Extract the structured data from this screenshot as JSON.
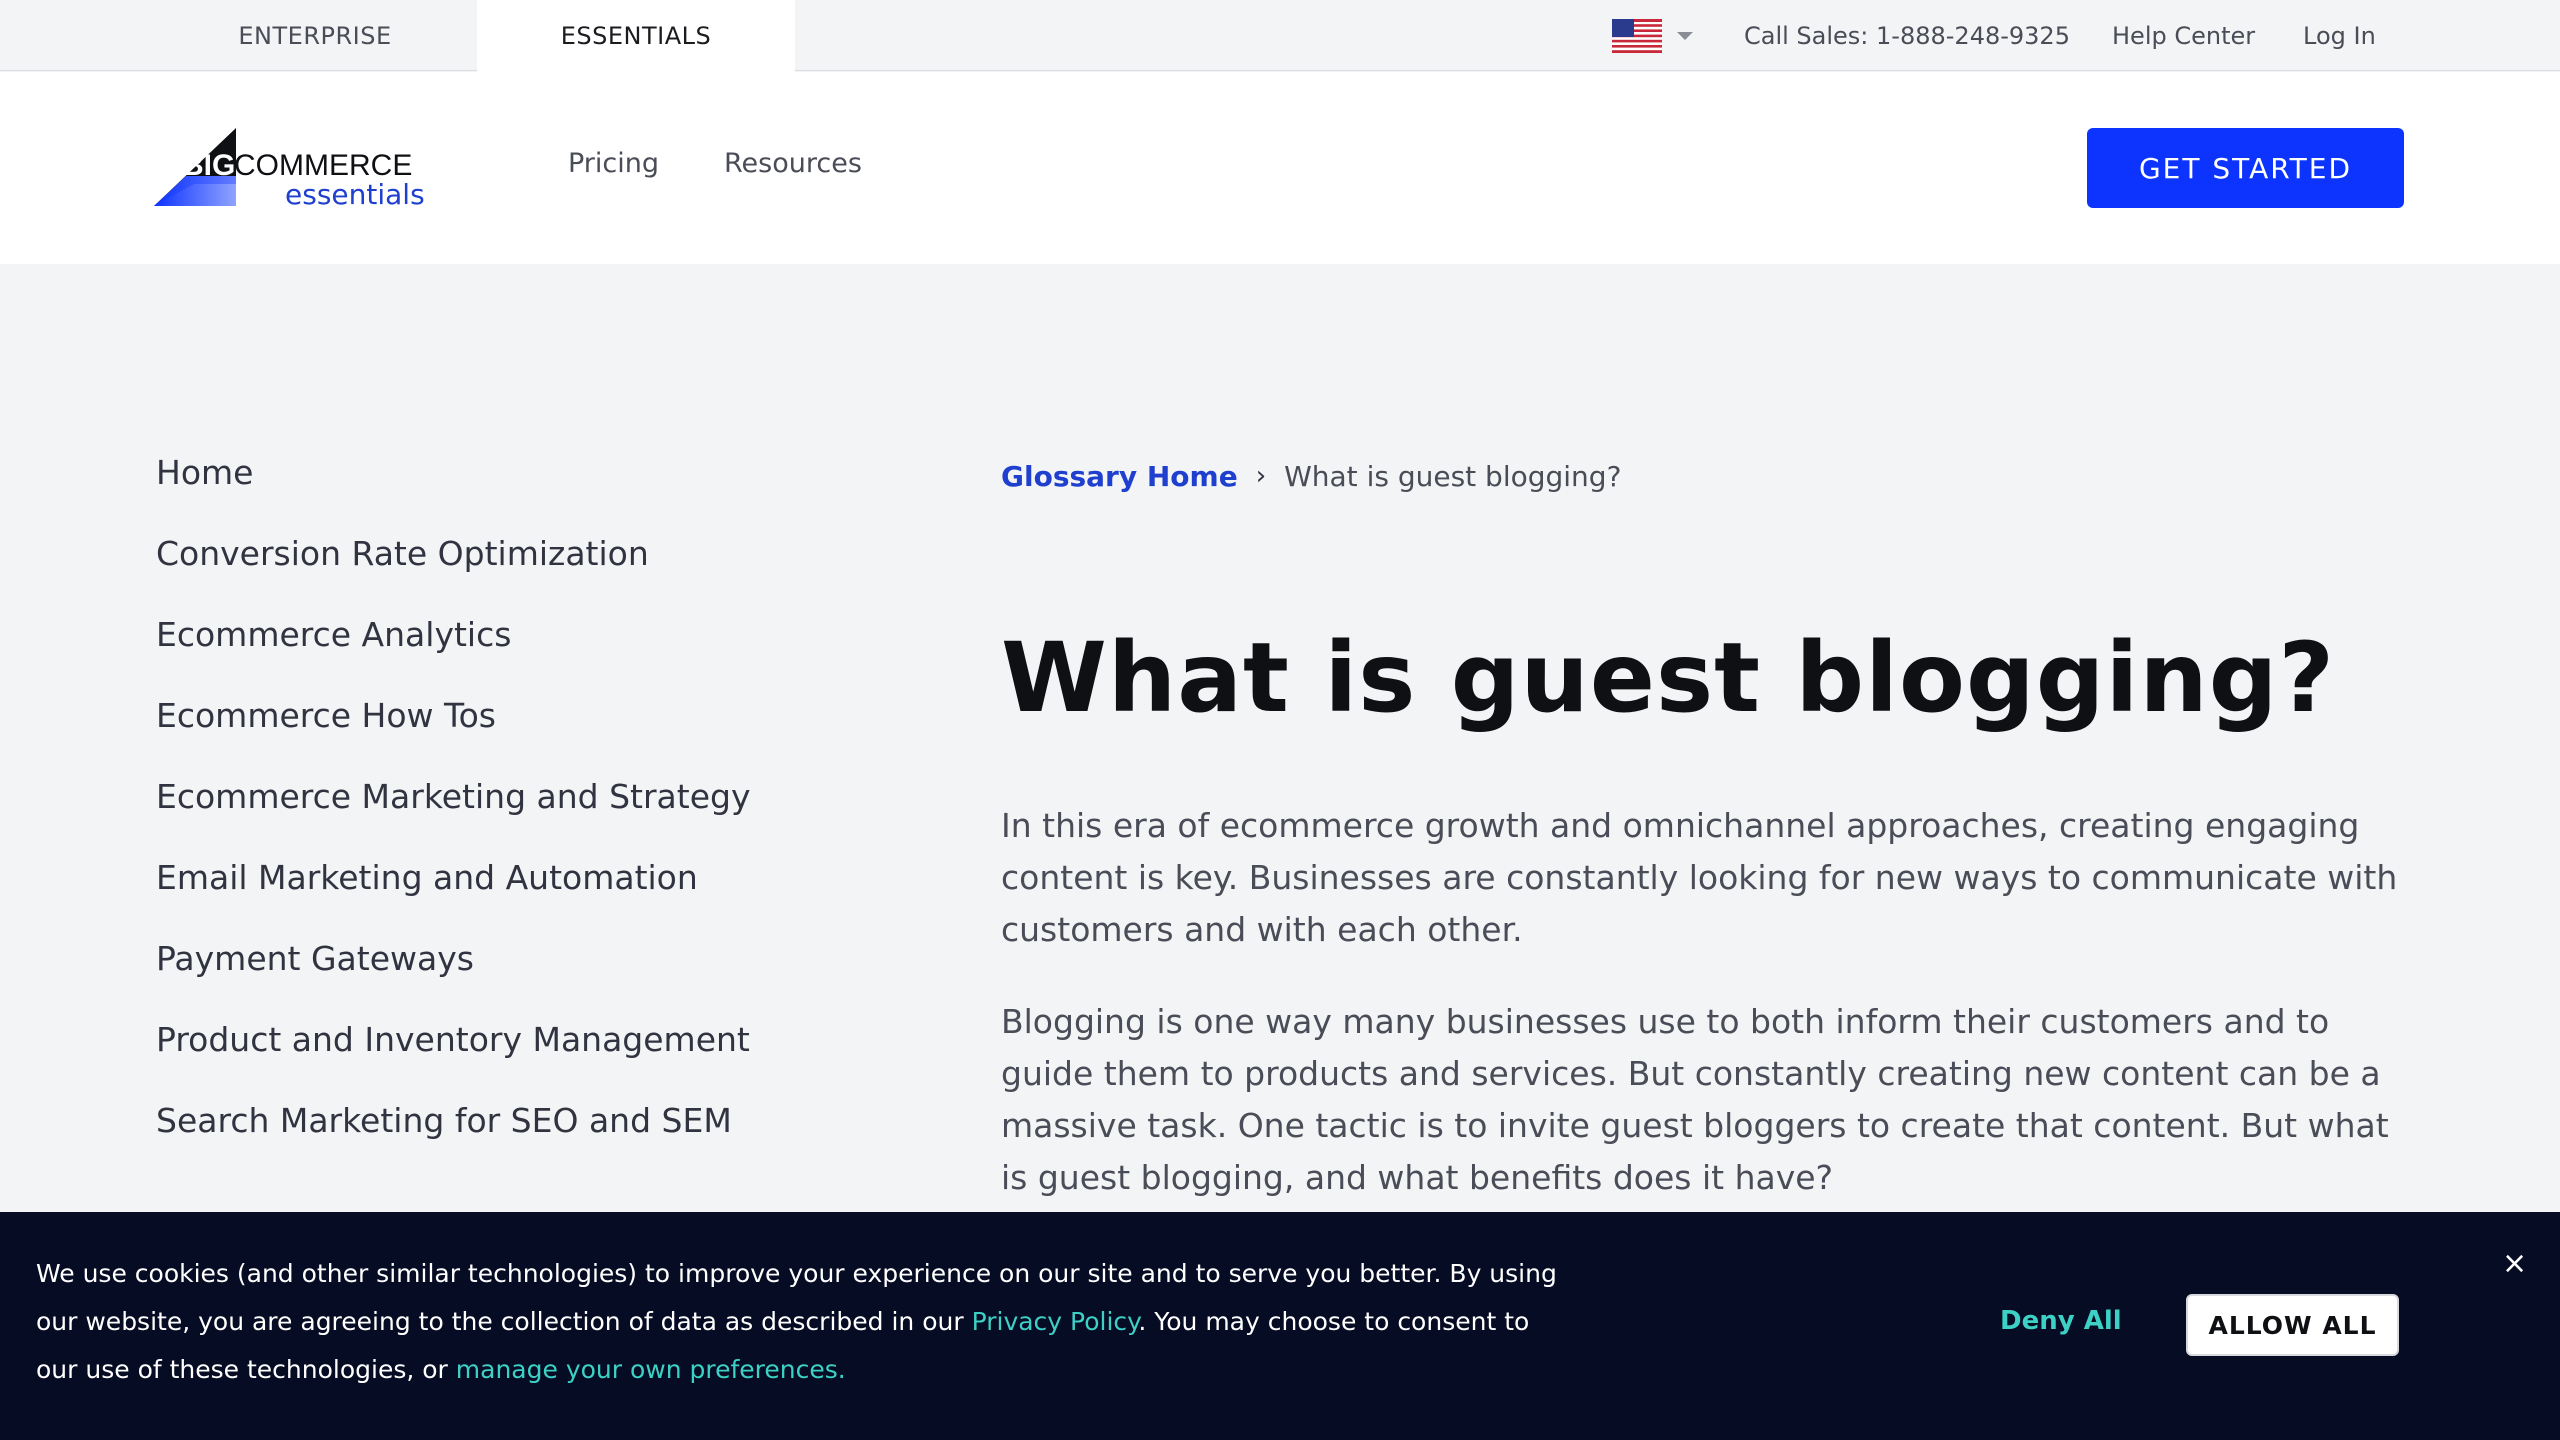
{
  "topbar": {
    "tabs": [
      {
        "label": "ENTERPRISE",
        "active": false
      },
      {
        "label": "ESSENTIALS",
        "active": true
      }
    ],
    "region_icon": "us-flag-icon",
    "call_sales": "Call Sales: 1-888-248-9325",
    "help_center": "Help Center",
    "login": "Log In"
  },
  "header": {
    "logo": {
      "big": "BIG",
      "commerce": "COMMERCE",
      "essentials": "essentials"
    },
    "nav": [
      "Pricing",
      "Resources"
    ],
    "cta": "GET STARTED"
  },
  "sidebar": {
    "items": [
      "Home",
      "Conversion Rate Optimization",
      "Ecommerce Analytics",
      "Ecommerce How Tos",
      "Ecommerce Marketing and Strategy",
      "Email Marketing and Automation",
      "Payment Gateways",
      "Product and Inventory Management",
      "Search Marketing for SEO and SEM"
    ]
  },
  "main": {
    "breadcrumb": {
      "home": "Glossary Home",
      "current": "What is guest blogging?"
    },
    "title": "What is guest blogging?",
    "paragraphs": [
      "In this era of ecommerce growth and omnichannel approaches, creating engaging content is key. Businesses are constantly looking for new ways to communicate with customers and with each other.",
      "Blogging is one way many businesses use to both inform their customers and to guide them to products and services. But constantly creating new content can be a massive task. One tactic is to invite guest bloggers to create that content. But what is guest blogging, and what benefits does it have?"
    ]
  },
  "cookie": {
    "text_1": "We use cookies (and other similar technologies) to improve your experience on our site and to serve you better. By using our website, you are agreeing to the collection of data as described in our ",
    "privacy_link": "Privacy Policy",
    "text_2": ". You may choose to consent to our use of these technologies, or ",
    "preferences_link": "manage your own preferences.",
    "deny": "Deny All",
    "allow": "ALLOW ALL",
    "close": "×"
  },
  "colors": {
    "accent_blue": "#0d33ff",
    "link_teal": "#3dd1c6",
    "banner_bg": "#060c23"
  }
}
